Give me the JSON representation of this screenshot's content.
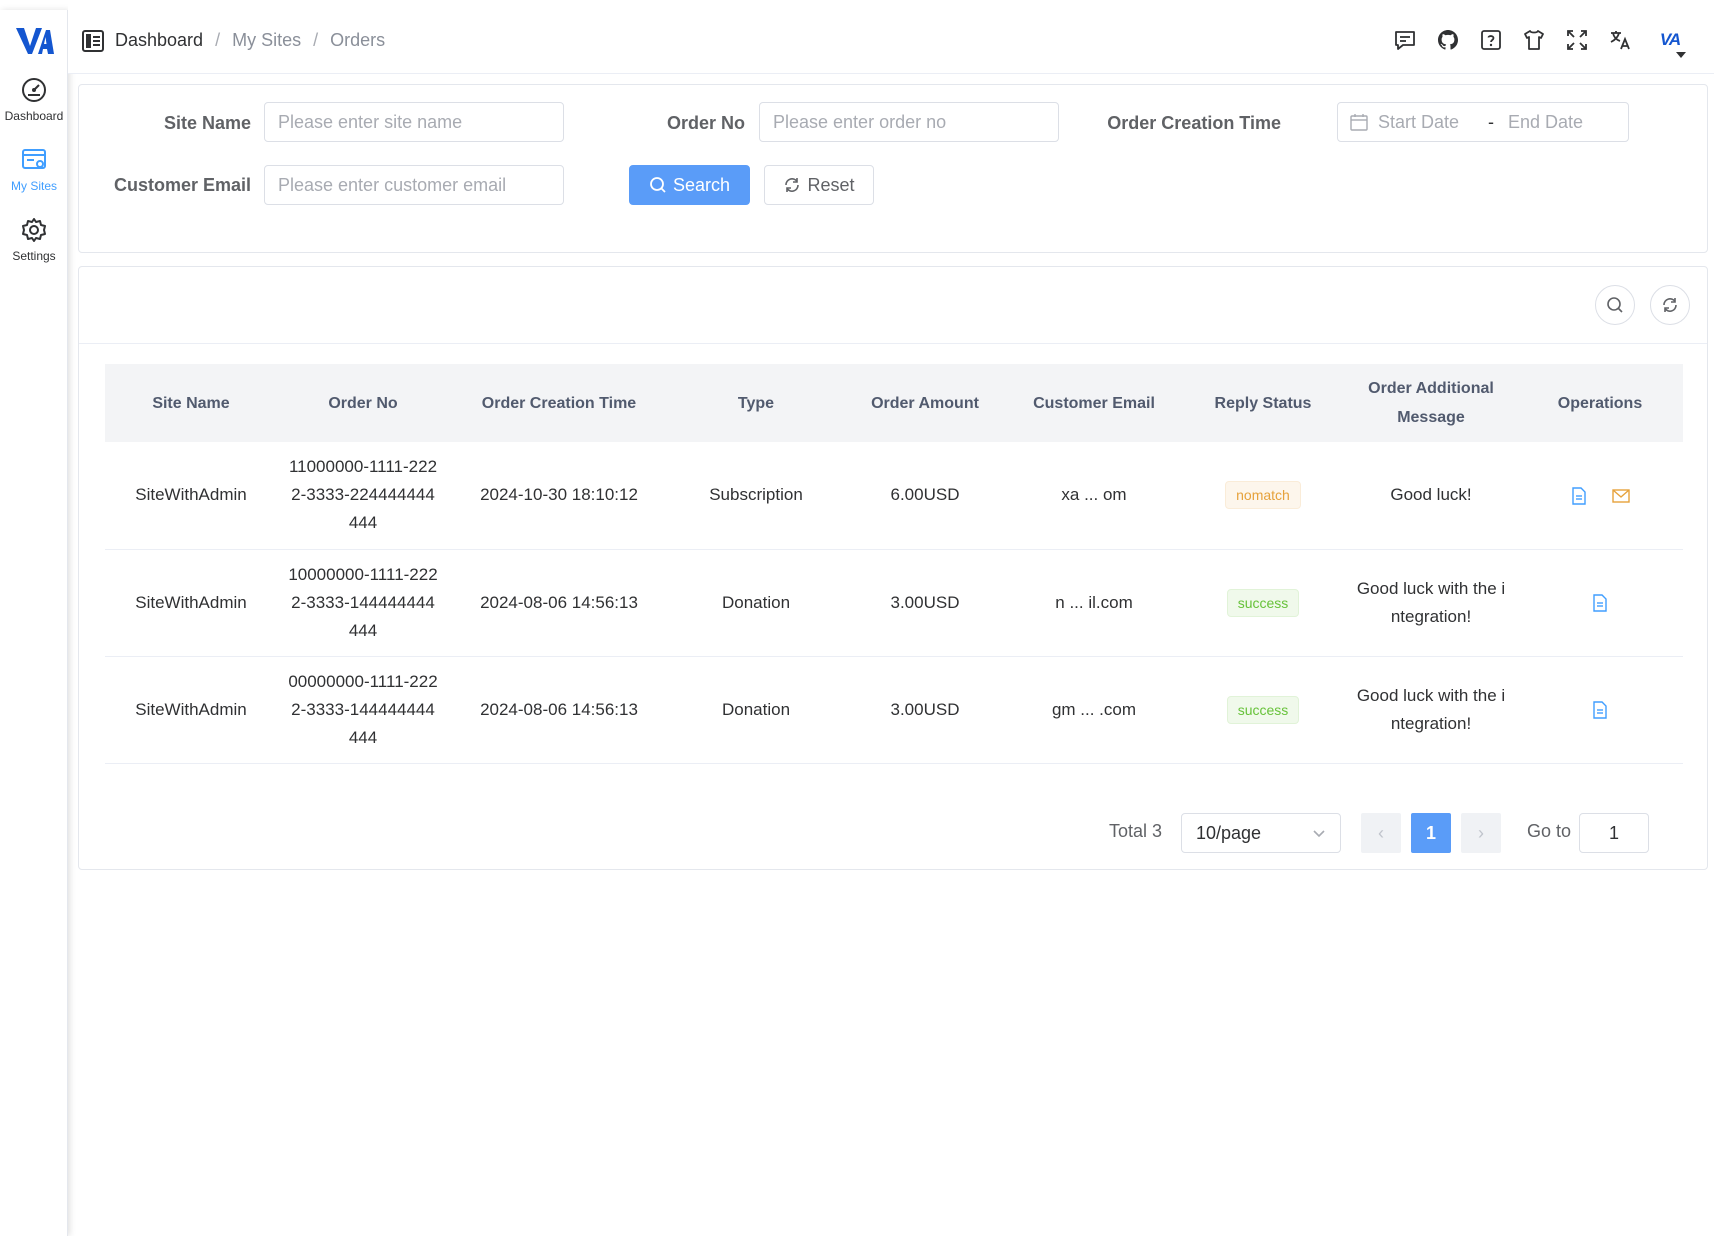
{
  "app": {
    "logo_text": "VA"
  },
  "sidebar": {
    "items": [
      {
        "label": "Dashboard",
        "icon": "dashboard-icon",
        "active": false
      },
      {
        "label": "My Sites",
        "icon": "sites-icon",
        "active": true
      },
      {
        "label": "Settings",
        "icon": "gear-icon",
        "active": false
      }
    ]
  },
  "header": {
    "breadcrumb": [
      "Dashboard",
      "My Sites",
      "Orders"
    ],
    "separator": "/",
    "avatar_text": "VA",
    "tools": [
      "message-icon",
      "github-icon",
      "help-icon",
      "shirt-icon",
      "fullscreen-icon",
      "translate-icon"
    ]
  },
  "search": {
    "site_name_label": "Site Name",
    "site_name_placeholder": "Please enter site name",
    "order_no_label": "Order No",
    "order_no_placeholder": "Please enter order no",
    "creation_time_label": "Order Creation Time",
    "start_placeholder": "Start Date",
    "range_sep": "-",
    "end_placeholder": "End Date",
    "email_label": "Customer Email",
    "email_placeholder": "Please enter customer email",
    "search_button": "Search",
    "reset_button": "Reset"
  },
  "table": {
    "columns": [
      "Site Name",
      "Order No",
      "Order Creation Time",
      "Type",
      "Order Amount",
      "Customer Email",
      "Reply Status",
      "Order Additional Message",
      "Operations"
    ],
    "rows": [
      {
        "site": "SiteWithAdmin",
        "order_no": "11000000-1111-2222-3333-224444444444",
        "time": "2024-10-30 18:10:12",
        "type": "Subscription",
        "amount": "6.00USD",
        "email": "xa ... om",
        "status": "nomatch",
        "message": "Good luck!",
        "ops": [
          "document-icon",
          "mail-icon"
        ]
      },
      {
        "site": "SiteWithAdmin",
        "order_no": "10000000-1111-2222-3333-144444444444",
        "time": "2024-08-06 14:56:13",
        "type": "Donation",
        "amount": "3.00USD",
        "email": "n ... il.com",
        "status": "success",
        "message": "Good luck with the integration!",
        "ops": [
          "document-icon"
        ]
      },
      {
        "site": "SiteWithAdmin",
        "order_no": "00000000-1111-2222-3333-144444444444",
        "time": "2024-08-06 14:56:13",
        "type": "Donation",
        "amount": "3.00USD",
        "email": "gm ... .com",
        "status": "success",
        "message": "Good luck with the integration!",
        "ops": [
          "document-icon"
        ]
      }
    ]
  },
  "pagination": {
    "total_text": "Total 3",
    "page_size": "10/page",
    "prev": "‹",
    "current_page": "1",
    "next": "›",
    "goto_label": "Go to",
    "goto_value": "1"
  },
  "colors": {
    "primary": "#5a9cf8",
    "brand": "#1456d0",
    "warning": "#e6a23c",
    "success": "#67c23a"
  }
}
